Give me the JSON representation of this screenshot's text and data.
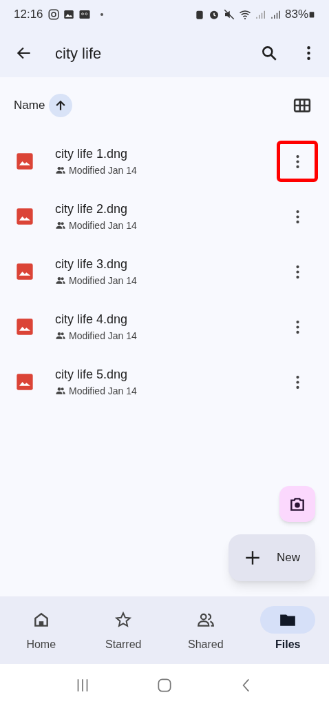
{
  "status_bar": {
    "time": "12:16",
    "battery": "83%"
  },
  "app_bar": {
    "title": "city life"
  },
  "sort": {
    "label": "Name"
  },
  "files": [
    {
      "name": "city life 1.dng",
      "meta": "Modified Jan 14",
      "highlighted": true
    },
    {
      "name": "city life 2.dng",
      "meta": "Modified Jan 14",
      "highlighted": false
    },
    {
      "name": "city life 3.dng",
      "meta": "Modified Jan 14",
      "highlighted": false
    },
    {
      "name": "city life 4.dng",
      "meta": "Modified Jan 14",
      "highlighted": false
    },
    {
      "name": "city life 5.dng",
      "meta": "Modified Jan 14",
      "highlighted": false
    }
  ],
  "new_button": {
    "label": "New"
  },
  "bottom_nav": [
    {
      "kind": "home",
      "label": "Home",
      "selected": false
    },
    {
      "kind": "star",
      "label": "Starred",
      "selected": false
    },
    {
      "kind": "shared",
      "label": "Shared",
      "selected": false
    },
    {
      "kind": "files",
      "label": "Files",
      "selected": true
    }
  ]
}
